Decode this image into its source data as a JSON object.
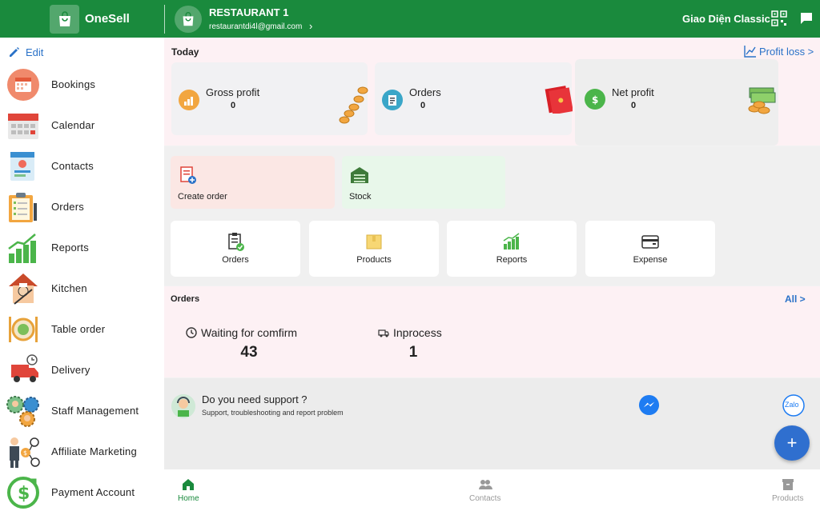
{
  "header": {
    "brand": "OneSell",
    "store_name": "RESTAURANT 1",
    "store_email": "restaurantdi4l@gmail.com",
    "theme_label": "Giao Diện Classic",
    "bg_color": "#1a8a3d"
  },
  "sidebar": {
    "edit_label": "Edit",
    "items": [
      {
        "label": "Bookings",
        "icon": "bookings-icon"
      },
      {
        "label": "Calendar",
        "icon": "calendar-icon"
      },
      {
        "label": "Contacts",
        "icon": "contacts-icon"
      },
      {
        "label": "Orders",
        "icon": "orders-clipboard-icon"
      },
      {
        "label": "Reports",
        "icon": "reports-chart-icon"
      },
      {
        "label": "Kitchen",
        "icon": "chef-icon"
      },
      {
        "label": "Table order",
        "icon": "table-order-icon"
      },
      {
        "label": "Delivery",
        "icon": "delivery-truck-icon"
      },
      {
        "label": "Staff Management",
        "icon": "staff-gears-icon"
      },
      {
        "label": "Affiliate Marketing",
        "icon": "affiliate-icon"
      },
      {
        "label": "Payment Account",
        "icon": "payment-account-icon"
      }
    ]
  },
  "today": {
    "title": "Today",
    "profit_link": "Profit loss >",
    "cards": [
      {
        "label": "Gross profit",
        "value": "0"
      },
      {
        "label": "Orders",
        "value": "0"
      },
      {
        "label": "Net profit",
        "value": "0"
      }
    ]
  },
  "actions": {
    "big": [
      {
        "label": "Create order"
      },
      {
        "label": "Stock"
      }
    ],
    "small": [
      {
        "label": "Orders"
      },
      {
        "label": "Products"
      },
      {
        "label": "Reports"
      },
      {
        "label": "Expense"
      }
    ]
  },
  "orders": {
    "title": "Orders",
    "all_link": "All >",
    "statuses": [
      {
        "label": "Waiting for comfirm",
        "value": "43"
      },
      {
        "label": "Inprocess",
        "value": "1"
      }
    ]
  },
  "support": {
    "title": "Do you need support ?",
    "subtitle": "Support, troubleshooting and report problem",
    "zalo_text": "Zalo",
    "fab_label": "+"
  },
  "bottom_nav": [
    {
      "label": "Home",
      "active": true
    },
    {
      "label": "Contacts",
      "active": false
    },
    {
      "label": "Products",
      "active": false
    }
  ]
}
